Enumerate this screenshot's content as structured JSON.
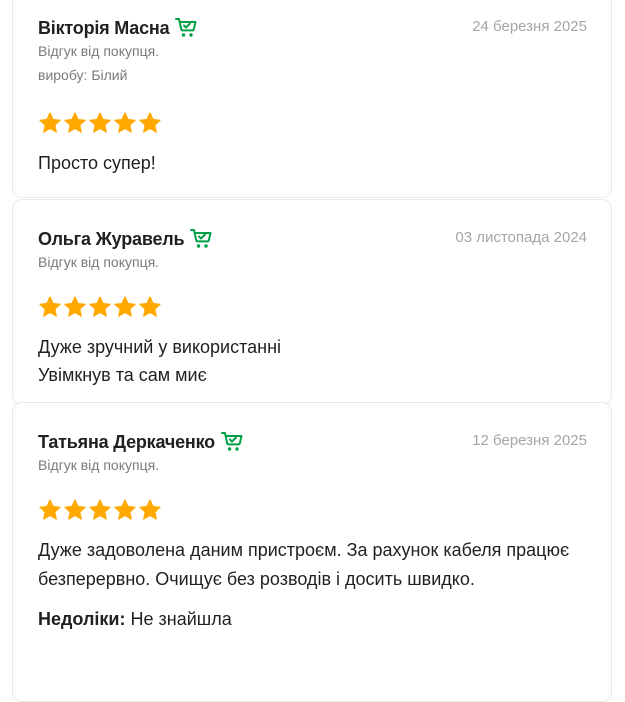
{
  "colors": {
    "star": "#ffa900",
    "cart_icon": "#00a046",
    "date_text": "#a6a6a6",
    "secondary_text": "#7a7a7a",
    "card_border": "#e9e9e9"
  },
  "reviews": [
    {
      "author": "Вікторія Масна",
      "verified_icon": "cart-check-icon",
      "date": "24 березня 2025",
      "buyer_label": "Відгук від покупця.",
      "variant": "виробу: Білий",
      "rating": 5,
      "text": "Просто супер!"
    },
    {
      "author": "Ольга Журавель",
      "verified_icon": "cart-check-icon",
      "date": "03 листопада 2024",
      "buyer_label": "Відгук від покупця.",
      "rating": 5,
      "text": "Дуже зручний у використанні\nУвімкнув та сам миє"
    },
    {
      "author": "Татьяна Деркаченко",
      "verified_icon": "cart-check-icon",
      "date": "12 березня 2025",
      "buyer_label": "Відгук від покупця.",
      "rating": 5,
      "text": "Дуже задоволена даним пристроєм. За рахунок кабеля працює безперервно. Очищує без розводів і досить швидко.",
      "cons_label": "Недоліки:",
      "cons_text": "Не знайшла"
    }
  ]
}
